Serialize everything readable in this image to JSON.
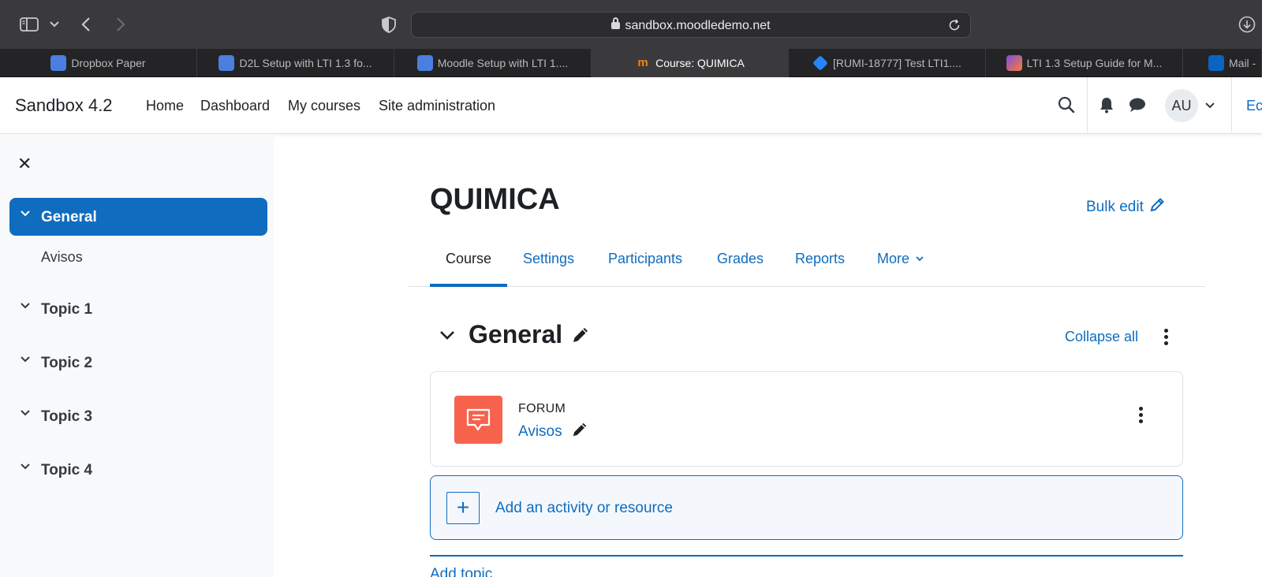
{
  "browser": {
    "url": "sandbox.moodledemo.net",
    "tabs": [
      {
        "title": "Dropbox Paper",
        "active": false,
        "favicon": "dropbox-icon"
      },
      {
        "title": "D2L Setup with LTI 1.3 fo...",
        "active": false,
        "favicon": "dropbox-icon"
      },
      {
        "title": "Moodle Setup with LTI 1....",
        "active": false,
        "favicon": "dropbox-icon"
      },
      {
        "title": "Course: QUIMICA",
        "active": true,
        "favicon": "moodle-icon"
      },
      {
        "title": "[RUMI-18777] Test LTI1....",
        "active": false,
        "favicon": "jira-icon"
      },
      {
        "title": "LTI 1.3 Setup Guide for M...",
        "active": false,
        "favicon": "atlassian-icon"
      },
      {
        "title": "Mail - ",
        "active": false,
        "favicon": "outlook-icon"
      }
    ]
  },
  "navbar": {
    "brand": "Sandbox 4.2",
    "links": [
      "Home",
      "Dashboard",
      "My courses",
      "Site administration"
    ],
    "avatar_initials": "AU",
    "edit_partial": "Ec"
  },
  "drawer": {
    "close_symbol": "✕",
    "sections": [
      {
        "label": "General",
        "active": true,
        "items": [
          "Avisos"
        ]
      },
      {
        "label": "Topic 1",
        "active": false
      },
      {
        "label": "Topic 2",
        "active": false
      },
      {
        "label": "Topic 3",
        "active": false
      },
      {
        "label": "Topic 4",
        "active": false
      }
    ]
  },
  "course": {
    "title": "QUIMICA",
    "bulk_edit": "Bulk edit",
    "tabs": [
      "Course",
      "Settings",
      "Participants",
      "Grades",
      "Reports",
      "More"
    ],
    "active_tab": "Course"
  },
  "section": {
    "title": "General",
    "collapse_all": "Collapse all"
  },
  "activity": {
    "type": "FORUM",
    "name": "Avisos"
  },
  "add_activity": {
    "plus": "+",
    "label": "Add an activity or resource"
  },
  "add_topic": "Add topic",
  "colors": {
    "primary": "#0f6cbf",
    "forum": "#f7634d",
    "browser_chrome": "#3a3a3c"
  }
}
